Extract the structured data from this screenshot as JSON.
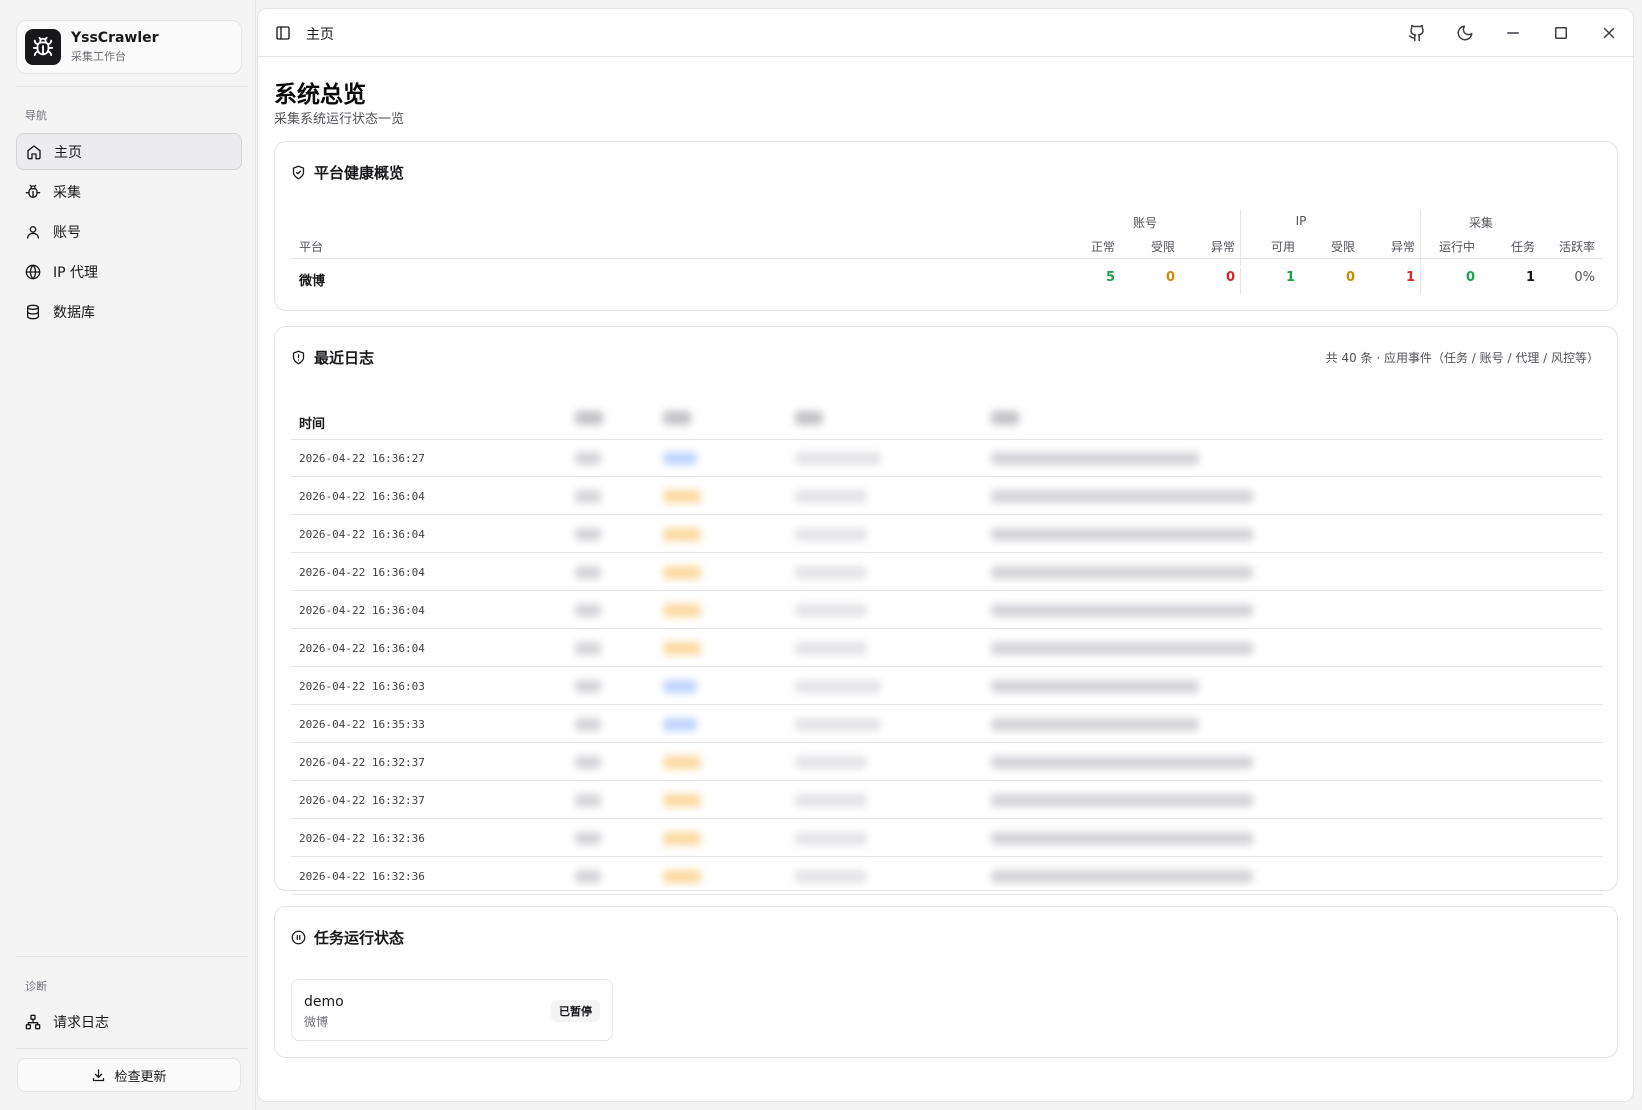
{
  "brand": {
    "name": "YssCrawler",
    "subtitle": "采集工作台"
  },
  "sidebar": {
    "nav_section": "导航",
    "items": [
      {
        "label": "主页",
        "icon": "home-icon",
        "active": true
      },
      {
        "label": "采集",
        "icon": "bug-icon"
      },
      {
        "label": "账号",
        "icon": "user-icon"
      },
      {
        "label": "IP 代理",
        "icon": "globe-icon"
      },
      {
        "label": "数据库",
        "icon": "database-icon"
      }
    ],
    "diag_section": "诊断",
    "diag_items": [
      {
        "label": "请求日志",
        "icon": "network-icon"
      }
    ],
    "update_button": "检查更新"
  },
  "topbar": {
    "title": "主页",
    "icons": [
      "sidebar-toggle-icon",
      "github-icon",
      "moon-icon",
      "minimize-icon",
      "maximize-icon",
      "close-icon"
    ]
  },
  "page": {
    "title": "系统总览",
    "subtitle": "采集系统运行状态一览"
  },
  "health": {
    "title": "平台健康概览",
    "groups": {
      "account": "账号",
      "ip": "IP",
      "crawl": "采集"
    },
    "platform_col": "平台",
    "columns": [
      "正常",
      "受限",
      "异常",
      "可用",
      "受限",
      "异常",
      "运行中",
      "任务",
      "活跃率"
    ],
    "rows": [
      {
        "platform": "微博",
        "values": [
          "5",
          "0",
          "0",
          "1",
          "0",
          "1",
          "0",
          "1",
          "0%"
        ]
      }
    ],
    "colors": {
      "ok": "#16a34a",
      "warn": "#ca8a04",
      "bad": "#dc2626",
      "neutral": "#18181b",
      "muted": "#52525b"
    }
  },
  "logs": {
    "title": "最近日志",
    "meta": "共 40 条 · 应用事件（任务 / 账号 / 代理 / 风控等）",
    "time_header": "时间",
    "rows": [
      {
        "time": "2026-04-22 16:36:27",
        "level": "info"
      },
      {
        "time": "2026-04-22 16:36:04",
        "level": "warn"
      },
      {
        "time": "2026-04-22 16:36:04",
        "level": "warn"
      },
      {
        "time": "2026-04-22 16:36:04",
        "level": "warn"
      },
      {
        "time": "2026-04-22 16:36:04",
        "level": "warn"
      },
      {
        "time": "2026-04-22 16:36:04",
        "level": "warn"
      },
      {
        "time": "2026-04-22 16:36:03",
        "level": "info"
      },
      {
        "time": "2026-04-22 16:35:33",
        "level": "info"
      },
      {
        "time": "2026-04-22 16:32:37",
        "level": "warn"
      },
      {
        "time": "2026-04-22 16:32:37",
        "level": "warn"
      },
      {
        "time": "2026-04-22 16:32:36",
        "level": "warn"
      },
      {
        "time": "2026-04-22 16:32:36",
        "level": "warn"
      }
    ]
  },
  "tasks": {
    "title": "任务运行状态",
    "items": [
      {
        "name": "demo",
        "platform": "微博",
        "status": "已暂停"
      }
    ]
  }
}
